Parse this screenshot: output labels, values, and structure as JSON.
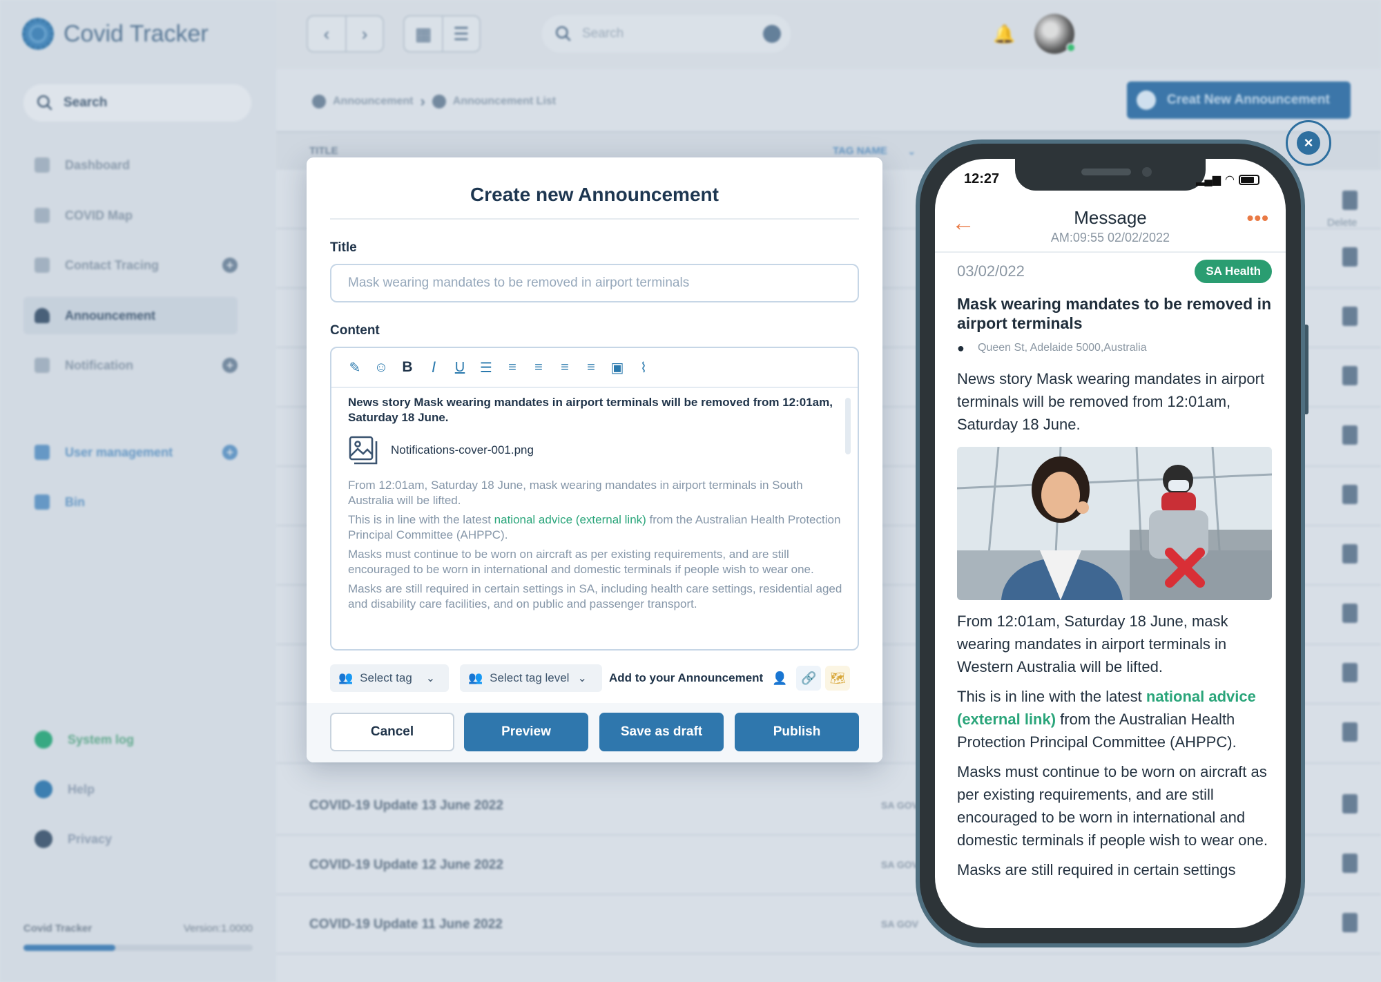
{
  "app": {
    "name": "Covid Tracker",
    "version_label": "Covid Tracker",
    "version": "Version:1.0000"
  },
  "sidebar": {
    "search_label": "Search",
    "items": [
      {
        "label": "Dashboard",
        "icon": "dashboard-icon"
      },
      {
        "label": "COVID Map",
        "icon": "map-icon"
      },
      {
        "label": "Contact Tracing",
        "icon": "tracing-icon"
      },
      {
        "label": "Announcement",
        "icon": "bell-icon"
      },
      {
        "label": "Notification",
        "icon": "notification-icon"
      },
      {
        "label": "User management",
        "icon": "user-management-icon"
      },
      {
        "label": "Bin",
        "icon": "bin-icon"
      }
    ],
    "bottom_items": [
      {
        "label": "System log",
        "color": "#2aa57a"
      },
      {
        "label": "Help",
        "color": "#2f77ad"
      },
      {
        "label": "Privacy",
        "color": "#3d5670"
      }
    ]
  },
  "topbar": {
    "search_placeholder": "Search"
  },
  "breadcrumb": {
    "parent": "Announcement",
    "current": "Announcement List"
  },
  "create_button_label": "Creat New Announcement",
  "table": {
    "col_title": "TITLE",
    "col_tag": "TAG NAME",
    "delete_label": "Delete",
    "rows": [
      {
        "title": "COVID-19 Update 13 June 2022",
        "tag": "SA GOV"
      },
      {
        "title": "COVID-19 Update 12 June 2022",
        "tag": "SA GOV"
      },
      {
        "title": "COVID-19 Update 11 June 2022",
        "tag": "SA GOV"
      }
    ]
  },
  "modal": {
    "heading": "Create new Announcement",
    "title_label": "Title",
    "title_value": "Mask wearing mandates to be removed in airport terminals",
    "content_label": "Content",
    "content": {
      "lead": "News story Mask wearing mandates in airport terminals will be removed from 12:01am, Saturday 18 June.",
      "attachment": "Notifications-cover-001.png",
      "p1": "From 12:01am, Saturday 18 June, mask wearing mandates in airport terminals in South Australia will be lifted.",
      "p2_before": "This is in line with the latest ",
      "p2_link": "national advice (external link)",
      "p2_after": " from the Australian Health Protection Principal Committee (AHPPC).",
      "p3": "Masks must continue to be worn on aircraft as per existing requirements, and are still encouraged to be worn in international and domestic terminals if people wish to wear one.",
      "p4": "Masks are still required in certain settings in SA, including health care settings, residential aged and disability care facilities, and on public and passenger transport."
    },
    "select_tag": "Select tag",
    "select_tag_level": "Select tag level",
    "add_to_label": "Add to your Announcement",
    "buttons": {
      "cancel": "Cancel",
      "preview": "Preview",
      "save_draft": "Save as draft",
      "publish": "Publish"
    }
  },
  "phone": {
    "time": "12:27",
    "header_title": "Message",
    "header_sub": "AM:09:55 02/02/2022",
    "date": "03/02/022",
    "badge": "SA Health",
    "headline": "Mask wearing mandates to be removed in airport terminals",
    "location": "Queen St, Adelaide 5000,Australia",
    "lead": "News story Mask wearing mandates in airport terminals will be removed from 12:01am, Saturday 18 June.",
    "p1": "From 12:01am, Saturday 18 June, mask wearing mandates in airport terminals in Western Australia will be lifted.",
    "p2_before": "This is in line with the latest ",
    "p2_link": "national advice (external link)",
    "p2_after": " from the Australian Health Protection Principal Committee (AHPPC).",
    "p3": "Masks must continue to be worn on aircraft as per existing requirements, and are still encouraged to be worn in international and domestic terminals if people wish to wear one.",
    "p4": "Masks are still required in certain settings"
  },
  "colors": {
    "primary": "#2f77ad",
    "accent_green": "#2aa57a",
    "accent_orange": "#e97a45",
    "badge_green": "#2a9d71"
  }
}
